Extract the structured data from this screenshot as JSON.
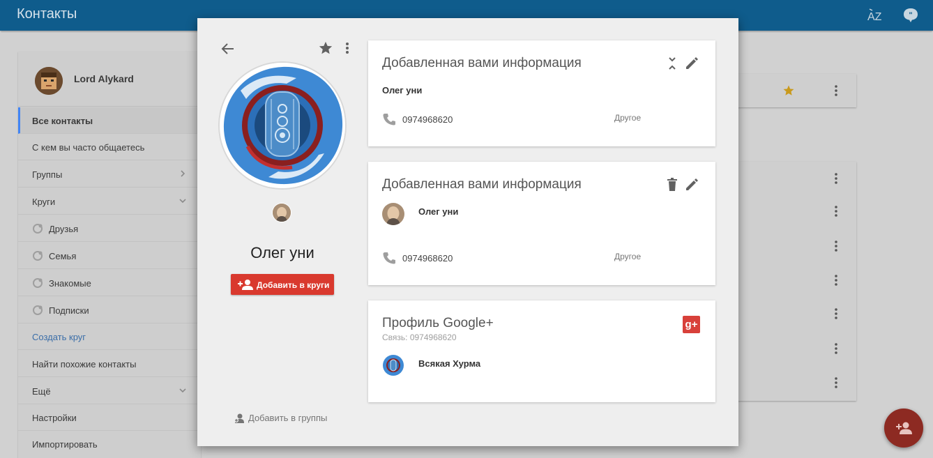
{
  "app": {
    "title": "Контакты",
    "sort_icon": "az-sort-icon",
    "feedback_icon": "feedback-icon"
  },
  "user": {
    "name": "Lord Alykard"
  },
  "sidebar": {
    "items": [
      {
        "label": "Все контакты",
        "active": true
      },
      {
        "label": "С кем вы часто общаетесь"
      },
      {
        "label": "Группы",
        "chevron": "right"
      },
      {
        "label": "Круги",
        "chevron": "down"
      },
      {
        "label": "Друзья",
        "icon": "circle-icon"
      },
      {
        "label": "Семья",
        "icon": "circle-icon"
      },
      {
        "label": "Знакомые",
        "icon": "circle-icon"
      },
      {
        "label": "Подписки",
        "icon": "circle-icon"
      },
      {
        "label": "Создать круг",
        "link": true
      },
      {
        "label": "Найти похожие контакты"
      },
      {
        "label": "Ещё",
        "chevron": "down"
      },
      {
        "label": "Настройки"
      },
      {
        "label": "Импортировать"
      }
    ]
  },
  "dialog": {
    "contact_name": "Олег уни",
    "add_to_circles": "Добавить в круги",
    "add_to_groups": "Добавить в группы",
    "cards": [
      {
        "title": "Добавленная вами информация",
        "name": "Олег уни",
        "phone": "0974968620",
        "phone_type": "Другое"
      },
      {
        "title": "Добавленная вами информация",
        "name": "Олег уни",
        "phone": "0974968620",
        "phone_type": "Другое"
      },
      {
        "title": "Профиль Google+",
        "subtitle": "Связь: 0974968620",
        "profile_name": "Всякая Хурма",
        "badge": "g+"
      }
    ]
  },
  "colors": {
    "topbar": "#0f5c8c",
    "accent_red": "#d9392e",
    "link_blue": "#3b6ea8",
    "star_gold": "#c99a1c"
  }
}
